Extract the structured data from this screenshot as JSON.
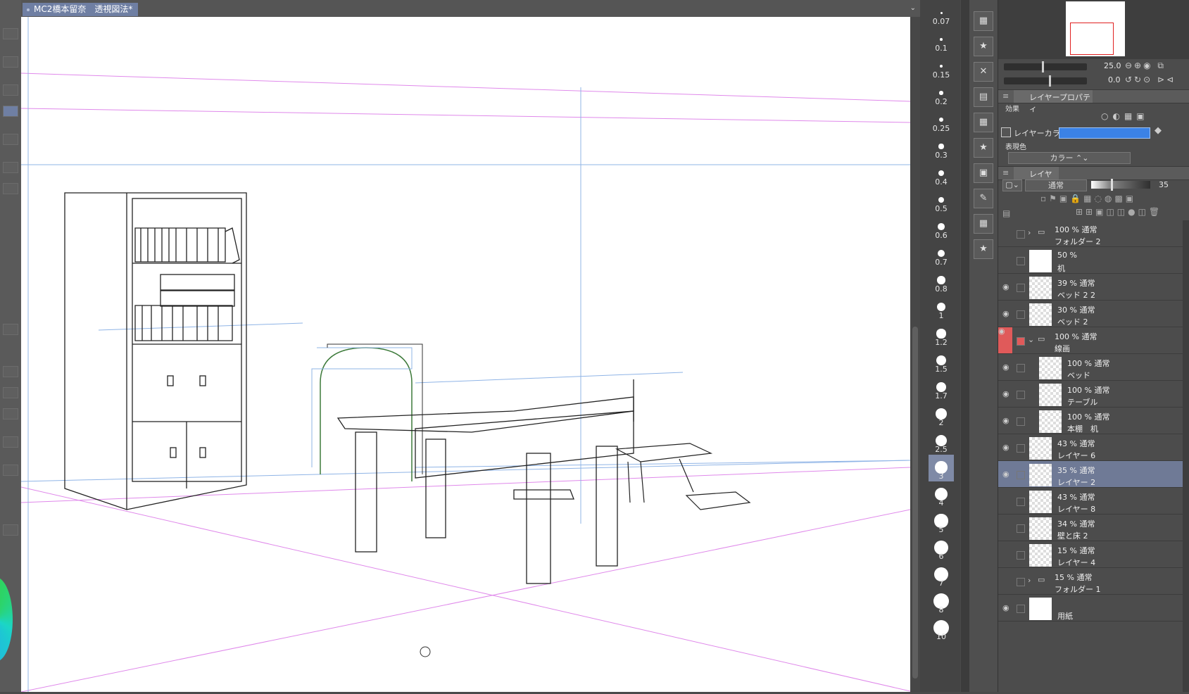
{
  "document": {
    "tab_title": "MC2橋本留奈　透視図法*"
  },
  "brush_sizes": [
    "0.07",
    "0.1",
    "0.15",
    "0.2",
    "0.25",
    "0.3",
    "0.4",
    "0.5",
    "0.6",
    "0.7",
    "0.8",
    "1",
    "1.2",
    "1.5",
    "1.7",
    "2",
    "2.5",
    "3",
    "4",
    "5",
    "6",
    "7",
    "8",
    "10"
  ],
  "selected_brush_size": "3",
  "navigator": {
    "zoom": "25.0",
    "rotation": "0.0"
  },
  "properties": {
    "tab": "レイヤープロパティ",
    "effect_label": "効果",
    "layer_color_label": "レイヤーカラー",
    "layer_color": "#3b82e6",
    "expression_color_label": "表現色",
    "expression_color_value": "カラー"
  },
  "layer_panel": {
    "tab": "レイヤー",
    "blend_mode": "通常",
    "opacity": "35"
  },
  "layers": [
    {
      "l1": "100 % 通常",
      "l2": "フォルダー 2",
      "folder": true
    },
    {
      "l1": "50 %",
      "l2": "机"
    },
    {
      "l1": "39 % 通常",
      "l2": "ベッド 2 2",
      "eye": true
    },
    {
      "l1": "30 % 通常",
      "l2": "ベッド 2",
      "eye": true
    },
    {
      "l1": "100 % 通常",
      "l2": "線画",
      "folder": true,
      "eye": true
    },
    {
      "l1": "100 % 通常",
      "l2": "ベッド",
      "eye": true
    },
    {
      "l1": "100 % 通常",
      "l2": "テーブル",
      "eye": true
    },
    {
      "l1": "100 % 通常",
      "l2": "本棚　机",
      "eye": true
    },
    {
      "l1": "43 % 通常",
      "l2": "レイヤー 6",
      "eye": true
    },
    {
      "l1": "35 % 通常",
      "l2": "レイヤー 2",
      "eye": true,
      "selected": true
    },
    {
      "l1": "43 % 通常",
      "l2": "レイヤー 8"
    },
    {
      "l1": "34 % 通常",
      "l2": "壁と床 2"
    },
    {
      "l1": "15 % 通常",
      "l2": "レイヤー 4"
    },
    {
      "l1": "15 % 通常",
      "l2": "フォルダー 1",
      "folder": true
    },
    {
      "l1": "",
      "l2": "用紙",
      "eye": true
    }
  ]
}
